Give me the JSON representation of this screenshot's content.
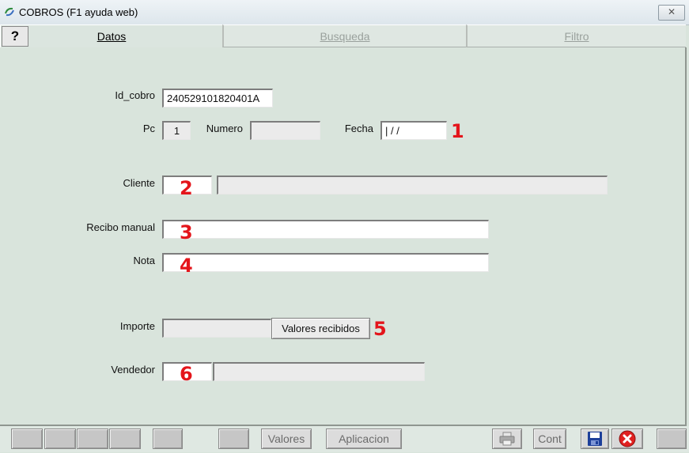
{
  "window": {
    "title": "COBROS (F1 ayuda web)",
    "close_glyph": "✕"
  },
  "tabs": {
    "help_glyph": "?",
    "datos": "Datos",
    "busqueda": "Busqueda",
    "filtro": "Filtro"
  },
  "form": {
    "id_cobro_label": "Id_cobro",
    "id_cobro_value": "240529101820401A",
    "pc_label": "Pc",
    "pc_value": "1",
    "numero_label": "Numero",
    "numero_value": "",
    "fecha_label": "Fecha",
    "fecha_value": "| / /",
    "cliente_label": "Cliente",
    "cliente_code": "",
    "cliente_name": "",
    "recibo_label": "Recibo manual",
    "recibo_value": "",
    "nota_label": "Nota",
    "nota_value": "",
    "importe_label": "Importe",
    "importe_value": "",
    "valores_recibidos_button": "Valores recibidos",
    "vendedor_label": "Vendedor",
    "vendedor_code": "",
    "vendedor_name": ""
  },
  "markers": [
    "1",
    "2",
    "3",
    "4",
    "5",
    "6"
  ],
  "bottom_bar": {
    "valores": "Valores",
    "aplicacion": "Aplicacion",
    "cont": "Cont",
    "icons": [
      "printer-icon",
      "save-icon",
      "cancel-icon"
    ]
  },
  "colors": {
    "marker": "#e4151b",
    "background": "#d9e4dc"
  }
}
